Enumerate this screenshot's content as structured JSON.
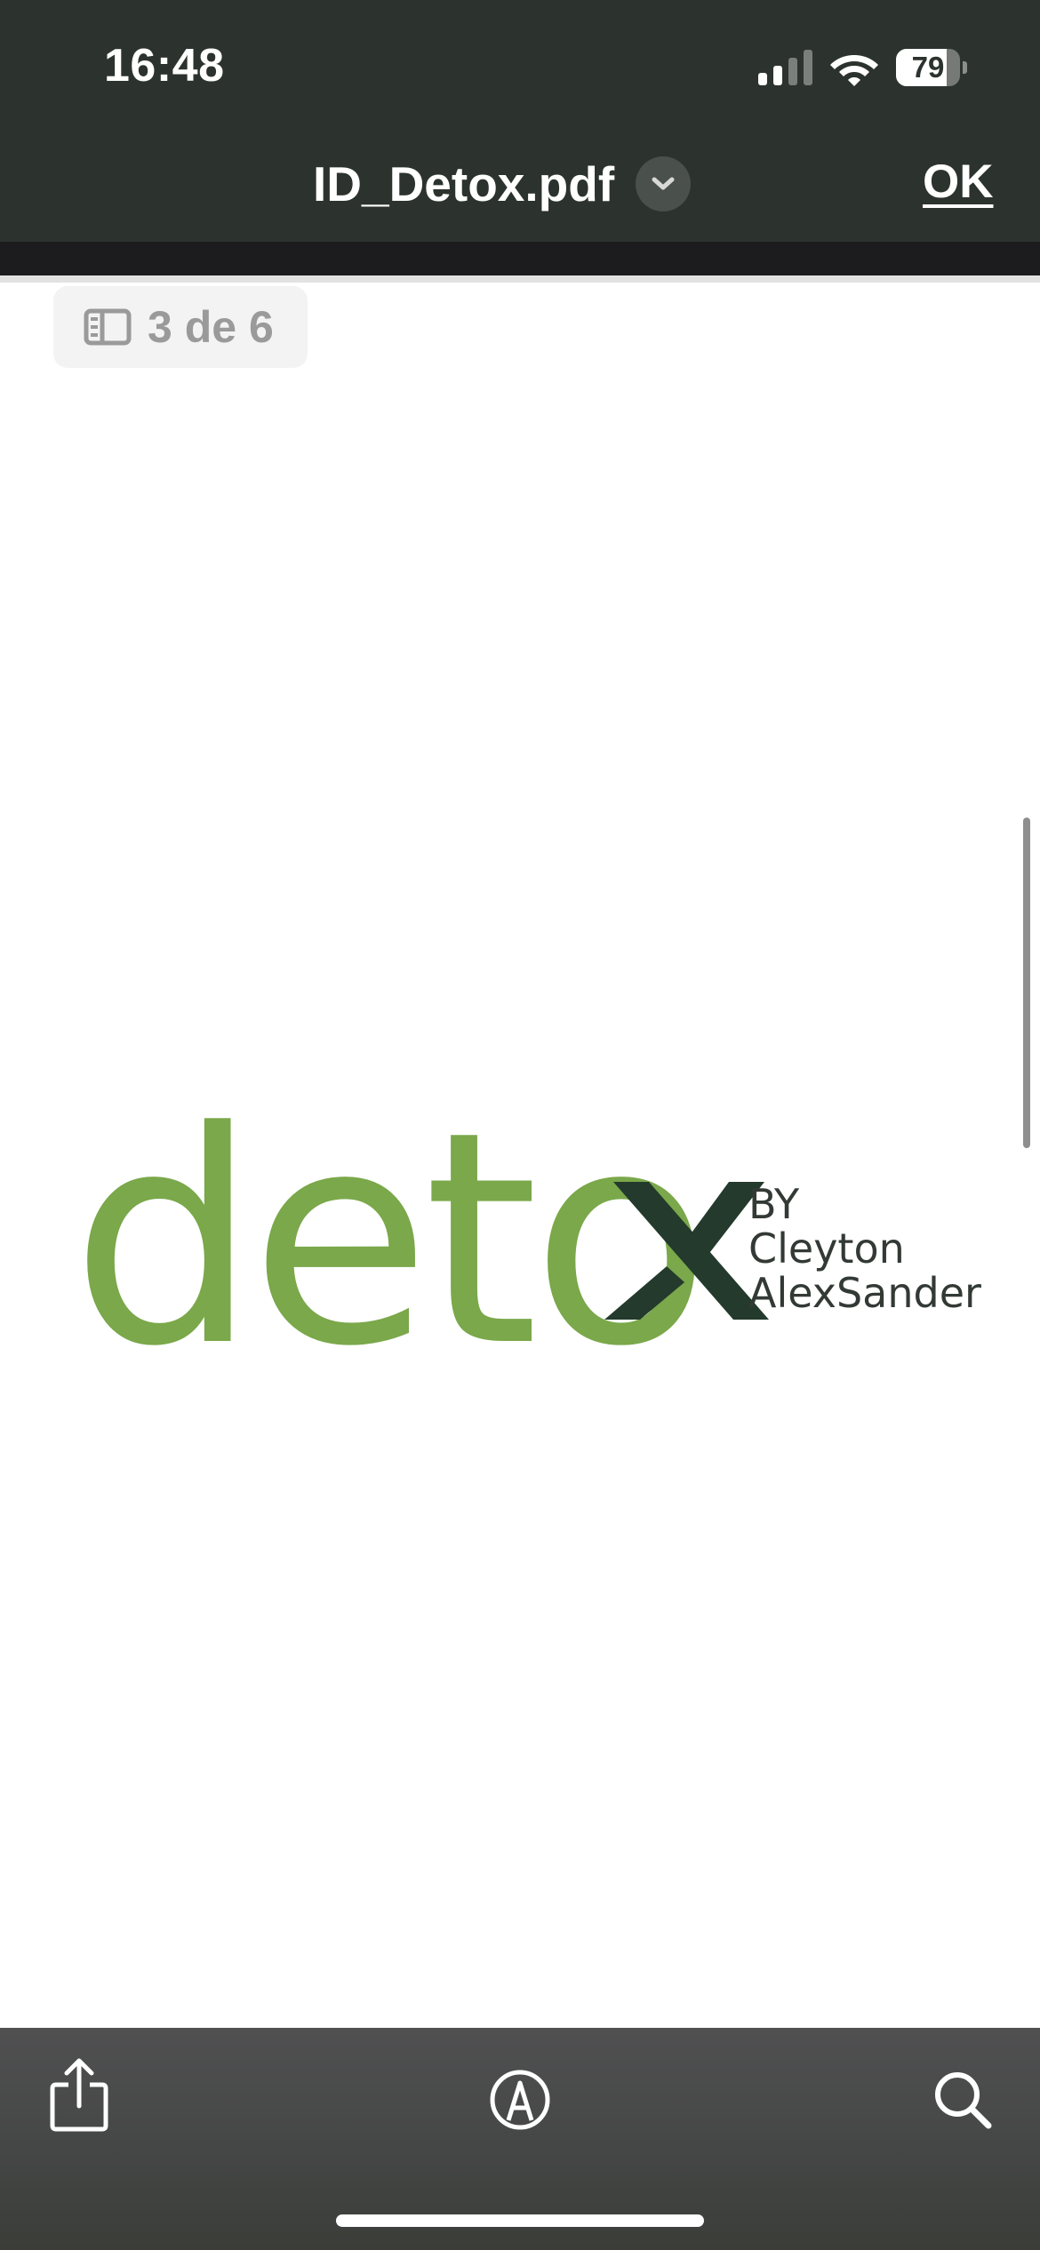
{
  "status_bar": {
    "time": "16:48",
    "battery_level": "79",
    "signal_bars": 2,
    "icons": [
      "cellular-signal-icon",
      "wifi-icon",
      "battery-icon"
    ]
  },
  "nav": {
    "title": "ID_Detox.pdf",
    "done_label": "OK",
    "title_menu_icon": "chevron-down-icon"
  },
  "page_indicator": {
    "label": "3 de 6",
    "icon": "sidebar-icon"
  },
  "document": {
    "logo_word": "deto",
    "byline": [
      "BY",
      "Cleyton",
      "AlexSander"
    ],
    "colors": {
      "logo_green": "#7aa84a",
      "logo_dark": "#233a2c"
    }
  },
  "toolbar": {
    "icons": [
      "share-icon",
      "markup-icon",
      "search-icon"
    ]
  },
  "colors": {
    "header_bg": "#2c332e",
    "toolbar_bg": "#454646"
  }
}
